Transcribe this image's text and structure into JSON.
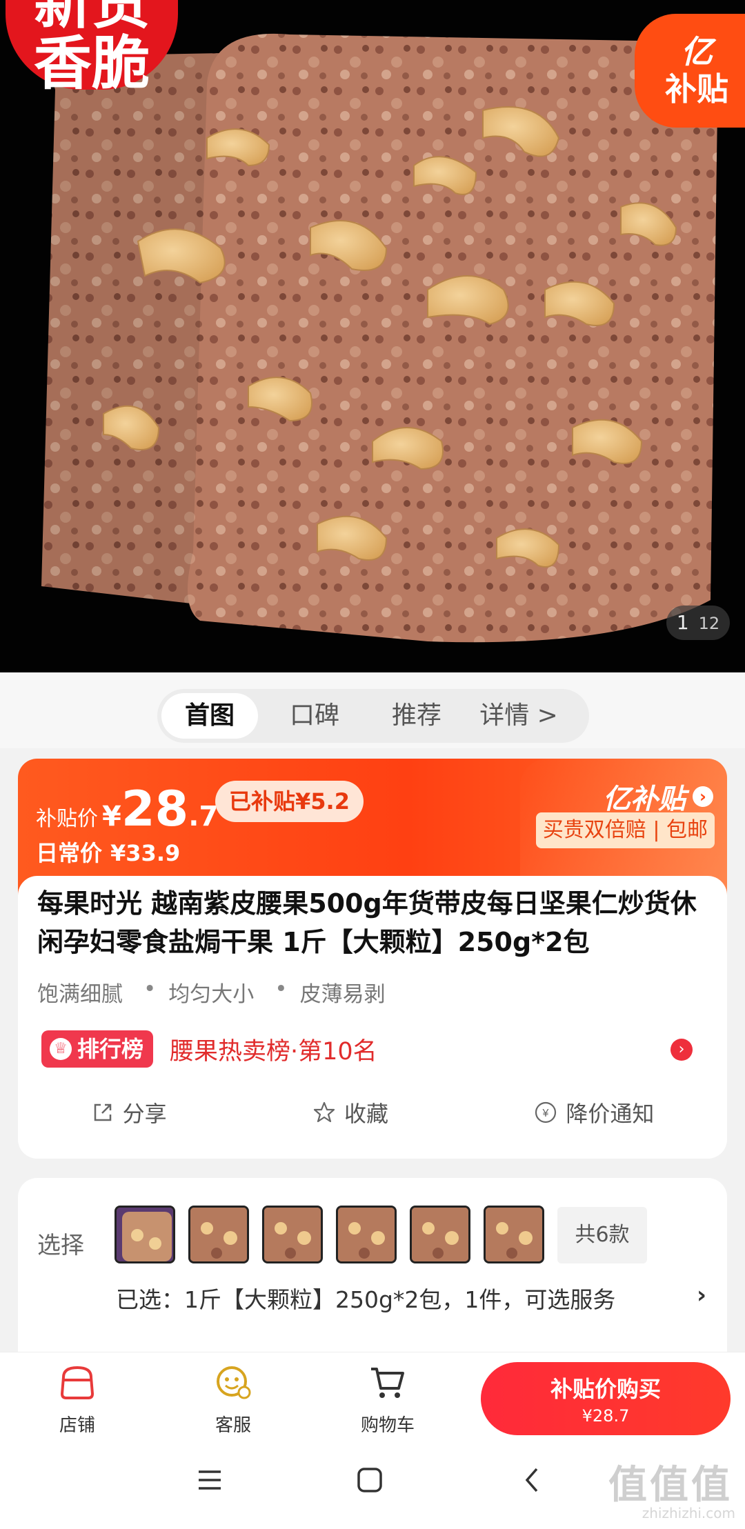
{
  "hero": {
    "badge_left": [
      "新货",
      "香脆"
    ],
    "badge_right_line1": "亿",
    "badge_right_line2": "补贴",
    "pager_current": "1",
    "pager_total": "12"
  },
  "tabs": [
    "首图",
    "口碑",
    "推荐",
    "详情 >"
  ],
  "price": {
    "label": "补贴价",
    "yen": "¥",
    "int": "28",
    "dec": ".7",
    "subsidy_pill": "已补贴¥5.2",
    "daily_label": "日常价",
    "daily_value": "¥33.9",
    "logo": "亿补贴",
    "logo_arrow": "›",
    "tag": "买贵双倍赔 | 包邮"
  },
  "product": {
    "title": "每果时光 越南紫皮腰果500g年货带皮每日坚果仁炒货休闲孕妇零食盐焗干果 1斤【大颗粒】250g*2包",
    "features": [
      "饱满细腻",
      "均匀大小",
      "皮薄易剥"
    ],
    "rank_pill": "排行榜",
    "rank_text": "腰果热卖榜·第10名",
    "actions": [
      "分享",
      "收藏",
      "降价通知"
    ]
  },
  "select": {
    "label": "选择",
    "count": "共6款",
    "chosen": "已选：1斤【大颗粒】250g*2包，1件，可选服务",
    "arrow": "›"
  },
  "bottom": {
    "store": "店铺",
    "service": "客服",
    "cart": "购物车",
    "buy_label": "补贴价购买",
    "buy_price": "¥28.7"
  },
  "watermark": {
    "main": "值值值",
    "url": "zhizhizhi.com"
  },
  "colors": {
    "accent": "#ff4a18",
    "buy": "#ff2a3a",
    "rank": "#f0384d"
  }
}
